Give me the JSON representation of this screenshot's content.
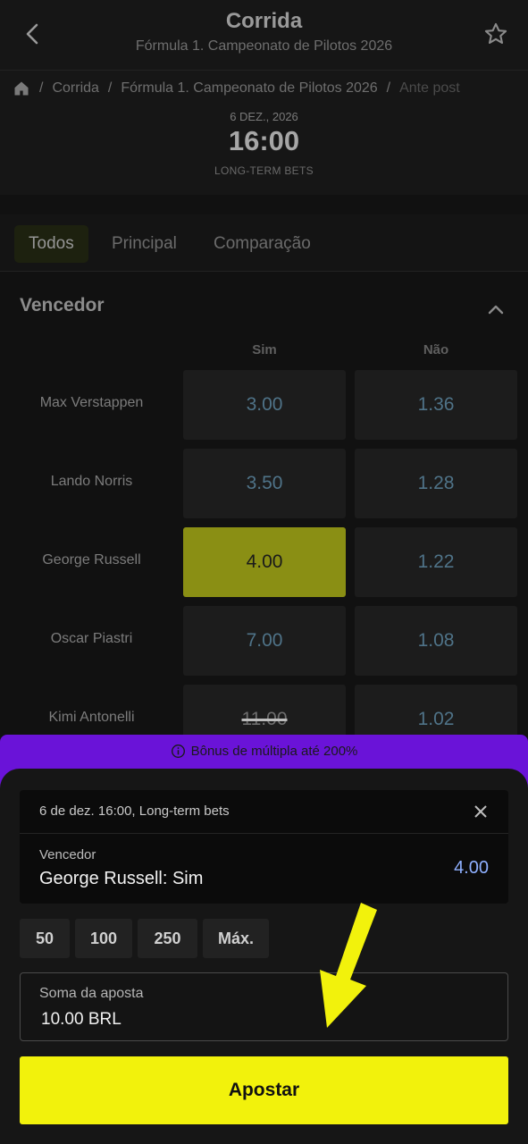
{
  "header": {
    "title": "Corrida",
    "subtitle": "Fórmula 1. Campeonato de Pilotos 2026"
  },
  "breadcrumb": {
    "items": [
      "Corrida",
      "Fórmula 1. Campeonato de Pilotos 2026",
      "Ante post"
    ]
  },
  "event": {
    "date": "6 DEZ., 2026",
    "time": "16:00",
    "tag": "LONG-TERM BETS"
  },
  "tabs": [
    {
      "label": "Todos",
      "active": true
    },
    {
      "label": "Principal",
      "active": false
    },
    {
      "label": "Comparação",
      "active": false
    }
  ],
  "market": {
    "title": "Vencedor",
    "columns": [
      "Sim",
      "Não"
    ],
    "rows": [
      {
        "name": "Max Verstappen",
        "yes": "3.00",
        "no": "1.36"
      },
      {
        "name": "Lando Norris",
        "yes": "3.50",
        "no": "1.28"
      },
      {
        "name": "George Russell",
        "yes": "4.00",
        "no": "1.22",
        "selected": "yes"
      },
      {
        "name": "Oscar Piastri",
        "yes": "7.00",
        "no": "1.08"
      },
      {
        "name": "Kimi Antonelli",
        "yes": "11.00",
        "no": "1.02",
        "suspended": "yes"
      }
    ]
  },
  "promo": {
    "text": "Bônus de múltipla até 200%"
  },
  "betslip": {
    "meta": "6 de dez. 16:00, Long-term bets",
    "market": "Vencedor",
    "pick": "George Russell: Sim",
    "price": "4.00",
    "quick_amounts": [
      "50",
      "100",
      "250",
      "Máx."
    ],
    "stake_label": "Soma da aposta",
    "stake_value": "10.00 BRL",
    "submit_label": "Apostar"
  },
  "colors": {
    "accent_yellow": "#f2f20c",
    "promo_purple": "#6a13d8",
    "selected_odd": "#8a8f14",
    "odds_text": "#4f7388",
    "price_text": "#8fb0ff"
  },
  "icons": [
    "back-arrow-icon",
    "star-icon",
    "home-icon",
    "chevron-up-icon",
    "info-icon",
    "close-icon",
    "arrow-annotation"
  ]
}
